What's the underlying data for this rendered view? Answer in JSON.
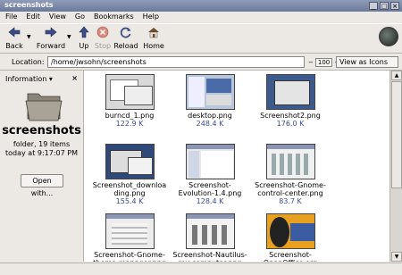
{
  "window": {
    "title": "screenshots"
  },
  "menu": [
    "File",
    "Edit",
    "View",
    "Go",
    "Bookmarks",
    "Help"
  ],
  "toolbar": {
    "back": "Back",
    "forward": "Forward",
    "up": "Up",
    "stop": "Stop",
    "reload": "Reload",
    "home": "Home"
  },
  "location": {
    "label": "Location:",
    "path": "/home/jwsohn/screenshots",
    "zoom": "100",
    "view_as": "View as Icons"
  },
  "sidebar": {
    "selector": "Information",
    "folder_name": "screenshots",
    "details": "folder, 19 items",
    "modified": "today at 9:17:07 PM",
    "open_with": "Open with..."
  },
  "files": [
    {
      "name": "burncd_1.png",
      "size": "122.9 K"
    },
    {
      "name": "desktop.png",
      "size": "248.4 K"
    },
    {
      "name": "Screenshot2.png",
      "size": "176.0 K"
    },
    {
      "name": "Screenshot_downloa ding.png",
      "size": "155.4 K"
    },
    {
      "name": "Screenshot- Evolution-1.4.png",
      "size": "128.4 K"
    },
    {
      "name": "Screenshot-Gnome- control-center.png",
      "size": "83.7 K"
    },
    {
      "name": "Screenshot-Gnome- theme-manager.png",
      "size": ""
    },
    {
      "name": "Screenshot-Nautilus- my-computer.png",
      "size": ""
    },
    {
      "name": "Screenshot- OpenOffice.org",
      "size": ""
    }
  ],
  "colors": {
    "titlebar": "#7a87a6",
    "size_text": "#3a4a8f",
    "window_bg": "#ece9e4"
  }
}
